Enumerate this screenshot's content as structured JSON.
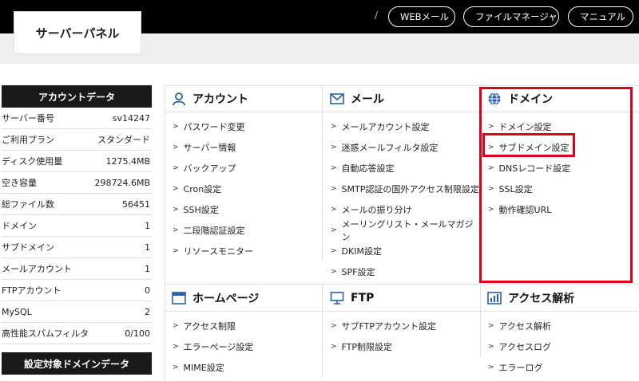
{
  "topbar": {
    "separator": "/",
    "webmail_label": "WEBメール",
    "filemanager_label": "ファイルマネージャ",
    "manual_label": "マニュアル"
  },
  "header": {
    "title": "サーバーパネル"
  },
  "account_data": {
    "heading": "アカウントデータ",
    "rows": [
      {
        "label": "サーバー番号",
        "value": "sv14247"
      },
      {
        "label": "ご利用プラン",
        "value": "スタンダード"
      },
      {
        "label": "ディスク使用量",
        "value": "1275.4MB"
      },
      {
        "label": "空き容量",
        "value": "298724.6MB"
      },
      {
        "label": "総ファイル数",
        "value": "56451"
      },
      {
        "label": "ドメイン",
        "value": "1"
      },
      {
        "label": "サブドメイン",
        "value": "1"
      },
      {
        "label": "メールアカウント",
        "value": "1"
      },
      {
        "label": "FTPアカウント",
        "value": "0"
      },
      {
        "label": "MySQL",
        "value": "2"
      },
      {
        "label": "高性能スパムフィルタ",
        "value": "0/100"
      }
    ],
    "domain_heading": "設定対象ドメインデータ"
  },
  "sections": {
    "account": {
      "title": "アカウント",
      "icon": "user-icon",
      "items": [
        "パスワード変更",
        "サーバー情報",
        "バックアップ",
        "Cron設定",
        "SSH設定",
        "二段階認証設定",
        "リソースモニター"
      ]
    },
    "mail": {
      "title": "メール",
      "icon": "envelope-icon",
      "items": [
        "メールアカウント設定",
        "迷惑メールフィルタ設定",
        "自動応答設定",
        "SMTP認証の国外アクセス制限設定",
        "メールの振り分け",
        "メーリングリスト・メールマガジン",
        "DKIM設定",
        "SPF設定"
      ]
    },
    "domain": {
      "title": "ドメイン",
      "icon": "globe-icon",
      "items": [
        "ドメイン設定",
        "サブドメイン設定",
        "DNSレコード設定",
        "SSL設定",
        "動作確認URL"
      ]
    },
    "homepage": {
      "title": "ホームページ",
      "icon": "browser-window-icon",
      "items": [
        "アクセス制限",
        "エラーページ設定",
        "MIME設定"
      ]
    },
    "ftp": {
      "title": "FTP",
      "icon": "monitor-icon",
      "items": [
        "サブFTPアカウント設定",
        "FTP制限設定"
      ]
    },
    "analytics": {
      "title": "アクセス解析",
      "icon": "bar-chart-icon",
      "items": [
        "アクセス解析",
        "アクセスログ",
        "エラーログ"
      ]
    }
  },
  "colors": {
    "highlight": "#e0001b",
    "topbar": "#000000",
    "sidebar_head": "#1a1a1a"
  }
}
